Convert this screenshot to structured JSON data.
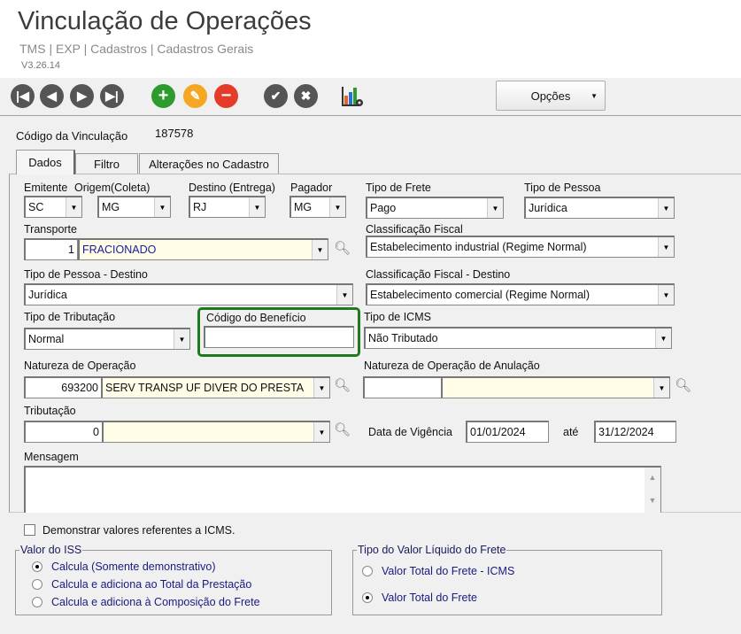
{
  "header": {
    "title": "Vinculação de Operações",
    "breadcrumb": "TMS | EXP | Cadastros | Cadastros Gerais",
    "version": "V3.26.14"
  },
  "toolbar": {
    "first": "first-record",
    "prev": "previous-record",
    "next": "next-record",
    "last": "last-record",
    "add": "add",
    "edit": "edit",
    "delete": "delete",
    "confirm": "confirm",
    "cancel": "cancel",
    "report": "report-settings",
    "options_label": "Opções",
    "colors": {
      "add": "#2e9b2e",
      "edit": "#f5a623",
      "delete": "#e53b2a",
      "nav": "#555555"
    }
  },
  "record": {
    "label": "Código da Vinculação",
    "value": "187578"
  },
  "tabs": [
    {
      "label": "Dados",
      "active": true
    },
    {
      "label": "Filtro"
    },
    {
      "label": "Alterações no Cadastro"
    }
  ],
  "form": {
    "emitente": {
      "label": "Emitente",
      "value": "SC"
    },
    "origem": {
      "label": "Origem(Coleta)",
      "value": "MG"
    },
    "destino": {
      "label": "Destino (Entrega)",
      "value": "RJ"
    },
    "pagador": {
      "label": "Pagador",
      "value": "MG"
    },
    "tipo_frete": {
      "label": "Tipo de Frete",
      "value": "Pago"
    },
    "tipo_pessoa": {
      "label": "Tipo de Pessoa",
      "value": "Jurídica"
    },
    "transporte": {
      "label": "Transporte",
      "code": "1",
      "value": "FRACIONADO"
    },
    "classificacao_fiscal": {
      "label": "Classificação Fiscal",
      "value": "Estabelecimento industrial (Regime Normal)"
    },
    "tipo_pessoa_destino": {
      "label": "Tipo de Pessoa - Destino",
      "value": "Jurídica"
    },
    "classificacao_fiscal_destino": {
      "label": "Classificação Fiscal - Destino",
      "value": "Estabelecimento comercial (Regime Normal)"
    },
    "tipo_tributacao": {
      "label": "Tipo de Tributação",
      "value": "Normal"
    },
    "codigo_beneficio": {
      "label": "Código do Benefício",
      "value": ""
    },
    "tipo_icms": {
      "label": "Tipo de ICMS",
      "value": "Não Tributado"
    },
    "natureza": {
      "label": "Natureza de Operação",
      "code": "693200",
      "value": "SERV TRANSP UF DIVER DO PRESTA"
    },
    "natureza_anulacao": {
      "label": "Natureza de Operação de Anulação",
      "code": "",
      "value": ""
    },
    "tributacao": {
      "label": "Tributação",
      "code": "0",
      "value": ""
    },
    "vigencia": {
      "label": "Data de Vigência",
      "from": "01/01/2024",
      "to_label": "até",
      "to": "31/12/2024"
    },
    "mensagem": {
      "label": "Mensagem",
      "value": ""
    }
  },
  "icms_checkbox": {
    "label": "Demonstrar valores referentes a ICMS.",
    "checked": false
  },
  "iss": {
    "legend": "Valor do ISS",
    "options": [
      "Calcula (Somente demonstrativo)",
      "Calcula e adiciona ao Total da Prestação",
      "Calcula e adiciona à Composição do Frete"
    ],
    "selected": 0
  },
  "liquido": {
    "legend": "Tipo do Valor Líquido do Frete",
    "options": [
      "Valor Total do Frete - ICMS",
      "Valor Total do Frete"
    ],
    "selected": 1
  }
}
